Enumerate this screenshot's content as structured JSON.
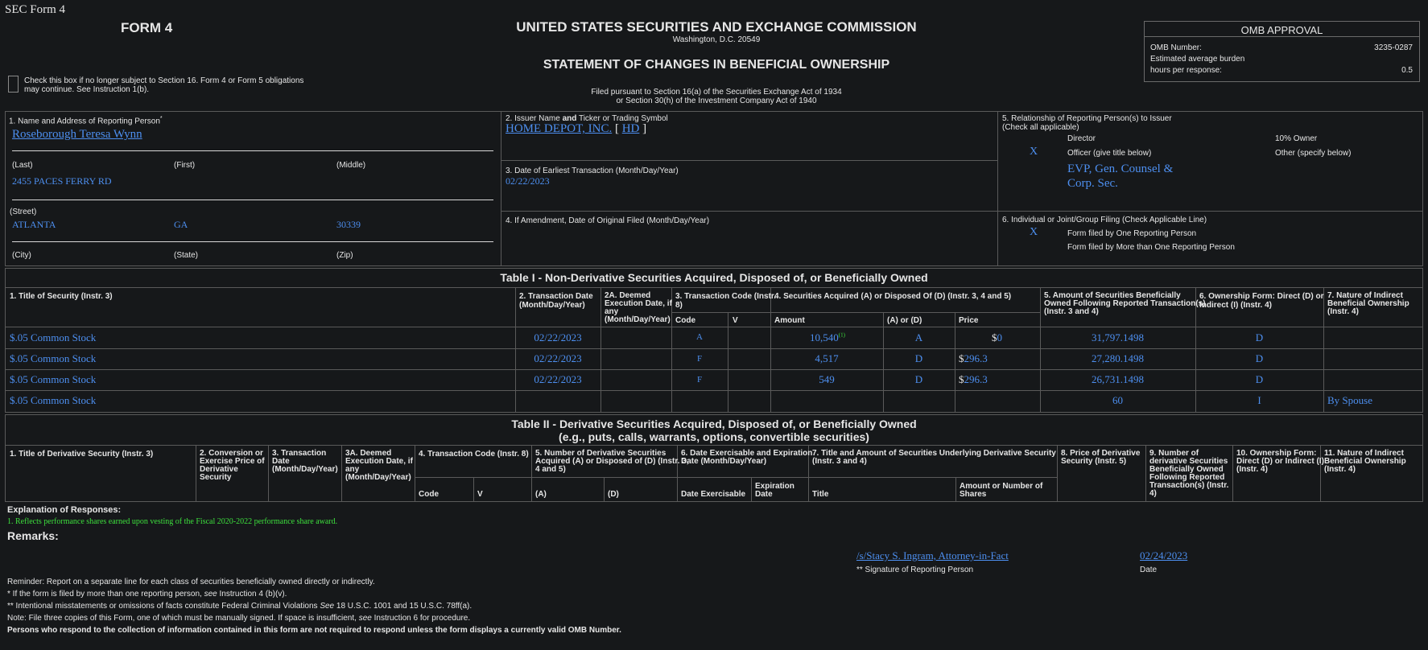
{
  "header": {
    "sec_form": "SEC Form 4",
    "form_title": "FORM 4",
    "agency": "UNITED STATES SECURITIES AND EXCHANGE COMMISSION",
    "agency_location": "Washington, D.C. 20549",
    "statement_title": "STATEMENT OF CHANGES IN BENEFICIAL OWNERSHIP",
    "filed_line1": "Filed pursuant to Section 16(a) of the Securities Exchange Act of 1934",
    "filed_line2": "or Section 30(h) of the Investment Company Act of 1940",
    "checkbox_text1": "Check this box if no longer subject to Section 16. Form 4 or Form 5 obligations",
    "checkbox_text2": "may continue. See Instruction 1(b)."
  },
  "omb": {
    "title": "OMB APPROVAL",
    "number_label": "OMB Number:",
    "number_value": "3235-0287",
    "burden_label1": "Estimated average burden",
    "burden_label2": "hours per response:",
    "burden_value": "0.5"
  },
  "box1": {
    "label": "1. Name and Address of Reporting Person",
    "asterisk": "*",
    "name": "Roseborough Teresa Wynn",
    "last_label": "(Last)",
    "first_label": "(First)",
    "middle_label": "(Middle)",
    "street_value": "2455 PACES FERRY RD",
    "street_label": "(Street)",
    "city_value": "ATLANTA",
    "state_value": "GA",
    "zip_value": "30339",
    "city_label": "(City)",
    "state_label": "(State)",
    "zip_label": "(Zip)"
  },
  "box2": {
    "label_a": "2. Issuer Name ",
    "label_and": "and",
    "label_b": " Ticker or Trading Symbol",
    "issuer": "HOME DEPOT, INC.",
    "bracket_open": "[",
    "ticker": "HD",
    "bracket_close": "]"
  },
  "box3": {
    "label": "3. Date of Earliest Transaction (Month/Day/Year)",
    "value": "02/22/2023"
  },
  "box4": {
    "label": "4. If Amendment, Date of Original Filed (Month/Day/Year)"
  },
  "box5": {
    "label1": "5. Relationship of Reporting Person(s) to Issuer",
    "label2": "(Check all applicable)",
    "director": "Director",
    "ten_pct": "10% Owner",
    "officer_mark": "X",
    "officer": "Officer (give title below)",
    "other": "Other (specify below)",
    "title_line1": "EVP, Gen. Counsel &",
    "title_line2": "Corp. Sec."
  },
  "box6": {
    "label": "6. Individual or Joint/Group Filing (Check Applicable Line)",
    "mark": "X",
    "one": "Form filed by One Reporting Person",
    "more": "Form filed by More than One Reporting Person"
  },
  "table1": {
    "title": "Table I - Non-Derivative Securities Acquired, Disposed of, or Beneficially Owned",
    "col1": "1. Title of Security (Instr. 3)",
    "col2a": "2. Transaction Date",
    "col2b": "(Month/Day/Year)",
    "col2A_1": "2A. Deemed",
    "col2A_2": "Execution Date, if",
    "col2A_3": "any",
    "col2A_4": "(Month/Day/Year)",
    "col3a": "3. Transaction Code (Instr.",
    "col3b": "8)",
    "col4": "4. Securities Acquired (A) or Disposed Of (D) (Instr. 3, 4 and 5)",
    "col5a": "5. Amount of Securities Beneficially",
    "col5b": "Owned Following Reported Transaction(s)",
    "col5c": "(Instr. 3 and 4)",
    "col6a": "6. Ownership Form: Direct (D) or",
    "col6b": "Indirect (I) (Instr. 4)",
    "col7a": "7. Nature of Indirect",
    "col7b": "Beneficial Ownership",
    "col7c": "(Instr. 4)",
    "sub_code": "Code",
    "sub_v": "V",
    "sub_amount": "Amount",
    "sub_aord": "(A) or (D)",
    "sub_price": "Price",
    "rows": [
      {
        "title": "$.05 Common Stock",
        "date": "02/22/2023",
        "code": "A",
        "amount": "10,540",
        "fn": "(1)",
        "aord": "A",
        "dollar": "$",
        "price": "0",
        "owned": "31,797.1498",
        "form": "D",
        "nature": ""
      },
      {
        "title": "$.05 Common Stock",
        "date": "02/22/2023",
        "code": "F",
        "amount": "4,517",
        "fn": "",
        "aord": "D",
        "dollar": "$",
        "price": "296.3",
        "owned": "27,280.1498",
        "form": "D",
        "nature": ""
      },
      {
        "title": "$.05 Common Stock",
        "date": "02/22/2023",
        "code": "F",
        "amount": "549",
        "fn": "",
        "aord": "D",
        "dollar": "$",
        "price": "296.3",
        "owned": "26,731.1498",
        "form": "D",
        "nature": ""
      },
      {
        "title": "$.05 Common Stock",
        "date": "",
        "code": "",
        "amount": "",
        "fn": "",
        "aord": "",
        "dollar": "",
        "price": "",
        "owned": "60",
        "form": "I",
        "nature": "By Spouse"
      }
    ]
  },
  "table2": {
    "title1": "Table II - Derivative Securities Acquired, Disposed of, or Beneficially Owned",
    "title2": "(e.g., puts, calls, warrants, options, convertible securities)",
    "c1": "1. Title of Derivative Security (Instr. 3)",
    "c2a": "2. Conversion or",
    "c2b": "Exercise Price of",
    "c2c": "Derivative",
    "c2d": "Security",
    "c3a": "3. Transaction",
    "c3b": "Date",
    "c3c": "(Month/Day/Year)",
    "c3Aa": "3A. Deemed",
    "c3Ab": "Execution Date, if",
    "c3Ac": "any",
    "c3Ad": "(Month/Day/Year)",
    "c4": "4. Transaction Code (Instr. 8)",
    "c5a": "5. Number of Derivative Securities",
    "c5b": "Acquired (A) or Disposed of (D) (Instr. 3,",
    "c5c": "4 and 5)",
    "c6a": "6. Date Exercisable and Expiration",
    "c6b": "Date (Month/Day/Year)",
    "c7a": "7. Title and Amount of Securities Underlying Derivative Security",
    "c7b": "(Instr. 3 and 4)",
    "c8a": "8. Price of Derivative",
    "c8b": "Security (Instr. 5)",
    "c9a": "9. Number of",
    "c9b": "derivative Securities",
    "c9c": "Beneficially Owned",
    "c9d": "Following Reported",
    "c9e": "Transaction(s) (Instr.",
    "c9f": "4)",
    "c10a": "10. Ownership Form:",
    "c10b": "Direct (D) or Indirect (I)",
    "c10c": "(Instr. 4)",
    "c11a": "11. Nature of Indirect",
    "c11b": "Beneficial Ownership",
    "c11c": "(Instr. 4)",
    "s_code": "Code",
    "s_v": "V",
    "s_a": "(A)",
    "s_d": "(D)",
    "s_exer": "Date Exercisable",
    "s_exp1": "Expiration",
    "s_exp2": "Date",
    "s_title": "Title",
    "s_amt1": "Amount or Number of",
    "s_amt2": "Shares"
  },
  "footer": {
    "explanation_label": "Explanation of Responses:",
    "footnote1": "1. Reflects performance shares earned upon vesting of the Fiscal 2020-2022 performance share award.",
    "remarks_label": "Remarks:",
    "signature": "/s/Stacy S. Ingram, Attorney-in-Fact",
    "sig_date": "02/24/2023",
    "sig_label": "** Signature of Reporting Person",
    "date_label": "Date",
    "reminder": "Reminder: Report on a separate line for each class of securities beneficially owned directly or indirectly.",
    "note1a": "* If the form is filed by more than one reporting person, ",
    "note1b": "see",
    "note1c": " Instruction 4 (b)(v).",
    "note2a": "** Intentional misstatements or omissions of facts constitute Federal Criminal Violations ",
    "note2b": "See",
    "note2c": " 18 U.S.C. 1001 and 15 U.S.C. 78ff(a).",
    "note3a": "Note: File three copies of this Form, one of which must be manually signed. If space is insufficient, ",
    "note3b": "see",
    "note3c": " Instruction 6 for procedure.",
    "note4": "Persons who respond to the collection of information contained in this form are not required to respond unless the form displays a currently valid OMB Number."
  }
}
